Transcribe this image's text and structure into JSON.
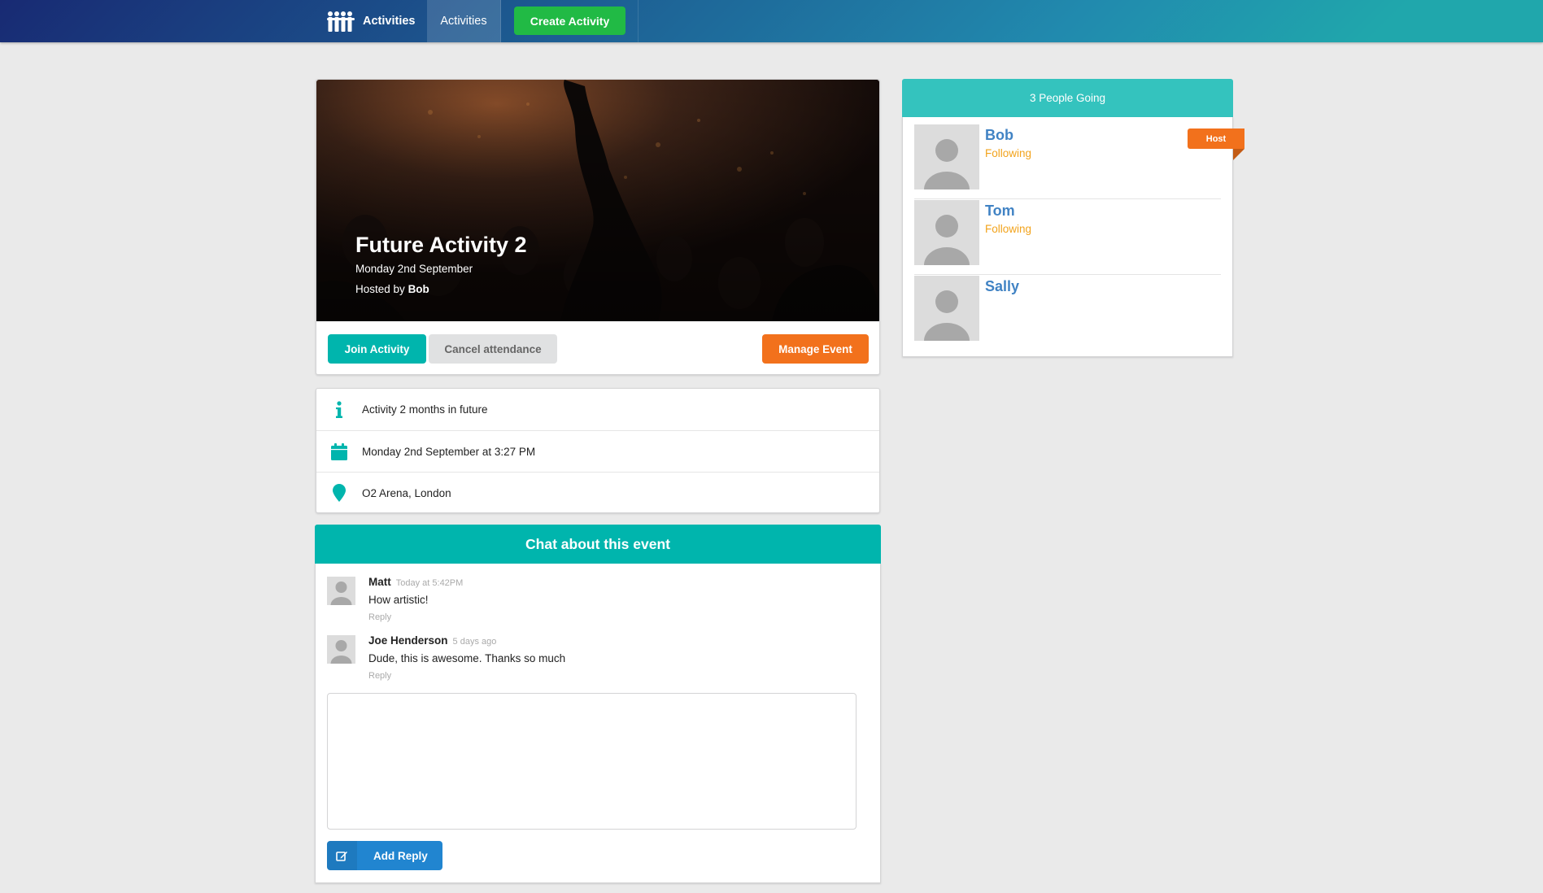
{
  "nav": {
    "brand_label": "Activities",
    "activities_label": "Activities",
    "create_label": "Create Activity"
  },
  "event": {
    "title": "Future Activity 2",
    "date": "Monday 2nd September",
    "hosted_by_prefix": "Hosted by",
    "host_name": "Bob",
    "join_label": "Join Activity",
    "cancel_label": "Cancel attendance",
    "manage_label": "Manage Event"
  },
  "details": [
    {
      "icon": "info-icon",
      "text": "Activity 2 months in future"
    },
    {
      "icon": "calendar-icon",
      "text": "Monday 2nd September at 3:27 PM"
    },
    {
      "icon": "map-marker-icon",
      "text": "O2 Arena, London"
    }
  ],
  "chat": {
    "title": "Chat about this event",
    "comments": [
      {
        "author": "Matt",
        "time": "Today at 5:42PM",
        "text": "How artistic!",
        "reply": "Reply"
      },
      {
        "author": "Joe Henderson",
        "time": "5 days ago",
        "text": "Dude, this is awesome. Thanks so much",
        "reply": "Reply"
      }
    ],
    "reply_placeholder": "",
    "add_reply_label": "Add Reply"
  },
  "attendees": {
    "heading": "3 People Going",
    "host_badge": "Host",
    "people": [
      {
        "name": "Bob",
        "status": "Following"
      },
      {
        "name": "Tom",
        "status": "Following"
      },
      {
        "name": "Sally",
        "status": ""
      }
    ]
  },
  "colors": {
    "teal": "#00b5ad",
    "orange": "#f2711c",
    "green": "#21ba45",
    "blue": "#2185d0",
    "link": "#4183c4",
    "following": "#f2a31c"
  }
}
